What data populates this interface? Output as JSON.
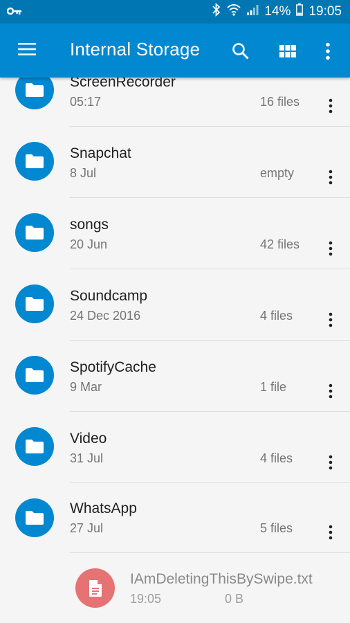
{
  "status_bar": {
    "battery": "14%",
    "time": "19:05",
    "icons": [
      "vpn-key-icon",
      "bluetooth-icon",
      "wifi-icon",
      "signal-icon",
      "battery-icon"
    ]
  },
  "app_bar": {
    "title": "Internal Storage",
    "actions": [
      "menu-icon",
      "search-icon",
      "grid-view-icon",
      "overflow-menu-icon"
    ]
  },
  "folders": [
    {
      "name": "ScreenRecorder",
      "date": "05:17",
      "count": "16 files"
    },
    {
      "name": "Snapchat",
      "date": "8 Jul",
      "count": "empty"
    },
    {
      "name": "songs",
      "date": "20 Jun",
      "count": "42 files"
    },
    {
      "name": "Soundcamp",
      "date": "24 Dec 2016",
      "count": "4 files"
    },
    {
      "name": "SpotifyCache",
      "date": "9 Mar",
      "count": "1 file"
    },
    {
      "name": "Video",
      "date": "31 Jul",
      "count": "4 files"
    },
    {
      "name": "WhatsApp",
      "date": "27 Jul",
      "count": "5 files"
    }
  ],
  "swiping_file": {
    "name": "IAmDeletingThisBySwipe.txt",
    "time": "19:05",
    "size": "0 B"
  },
  "colors": {
    "status_bar": "#0077b3",
    "app_bar": "#0288d1",
    "folder_icon_bg": "#0288d1",
    "file_icon_bg": "#e57373",
    "background": "#f5f5f5"
  }
}
